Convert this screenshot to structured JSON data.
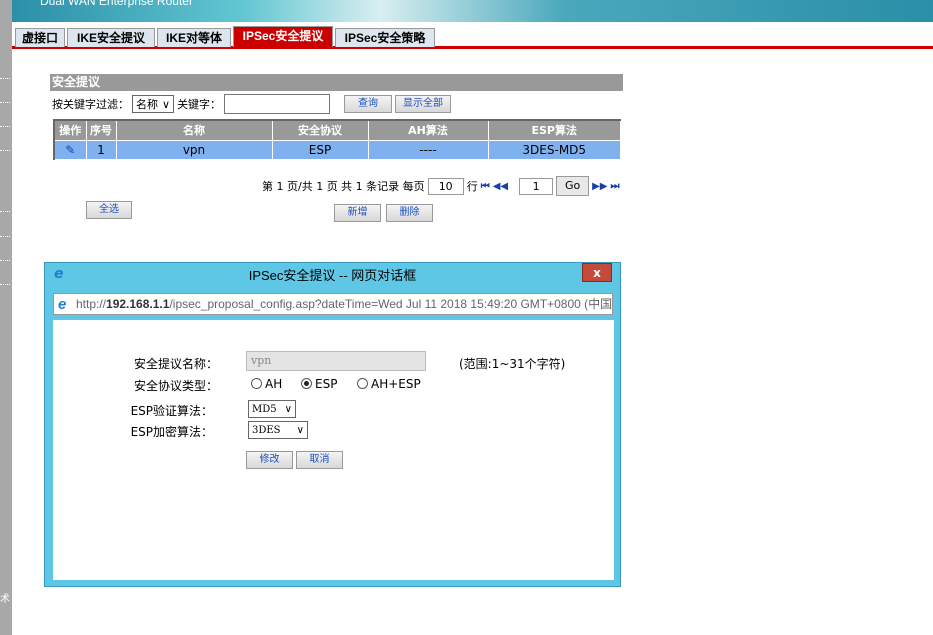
{
  "header": {
    "banner_text": "Dual WAN Enterprise Router"
  },
  "sidebar": {
    "partial_text": "术"
  },
  "tabs": [
    {
      "label": "虚接口"
    },
    {
      "label": "IKE安全提议"
    },
    {
      "label": "IKE对等体"
    },
    {
      "label": "IPSec安全提议",
      "active": true
    },
    {
      "label": "IPSec安全策略"
    }
  ],
  "section": {
    "title": "安全提议"
  },
  "filter": {
    "label": "按关键字过滤：",
    "field_value": "名称",
    "keyword_label": "关键字：",
    "keyword_value": "",
    "search_label": "查询",
    "show_all_label": "显示全部"
  },
  "table": {
    "columns": [
      "操作",
      "序号",
      "名称",
      "安全协议",
      "AH算法",
      "ESP算法"
    ],
    "rows": [
      {
        "index": "1",
        "name": "vpn",
        "protocol": "ESP",
        "ah": "----",
        "esp": "3DES-MD5"
      }
    ]
  },
  "pager": {
    "text1": "第 1 页/共 1 页 共 1 条记录 每页",
    "per_page": "10",
    "text2": "行",
    "page": "1",
    "go_label": "Go",
    "first": "⏮",
    "prev": "◀◀",
    "next": "▶▶",
    "last": "⏭"
  },
  "buttons": {
    "select_all": "全选",
    "add": "新增",
    "delete": "删除"
  },
  "dialog": {
    "title": "IPSec安全提议 -- 网页对话框",
    "close": "x",
    "url_prefix": "http://",
    "url_host": "192.168.1.1",
    "url_rest": "/ipsec_proposal_config.asp?dateTime=Wed Jul 11 2018 15:49:20 GMT+0800 (中国",
    "name_label": "安全提议名称：",
    "name_value": "vpn",
    "name_hint": "(范围:1~31个字符)",
    "proto_label": "安全协议类型：",
    "proto_options": [
      "AH",
      "ESP",
      "AH+ESP"
    ],
    "proto_selected": "ESP",
    "auth_label": "ESP验证算法：",
    "auth_value": "MD5",
    "enc_label": "ESP加密算法：",
    "enc_value": "3DES",
    "modify": "修改",
    "cancel": "取消"
  }
}
